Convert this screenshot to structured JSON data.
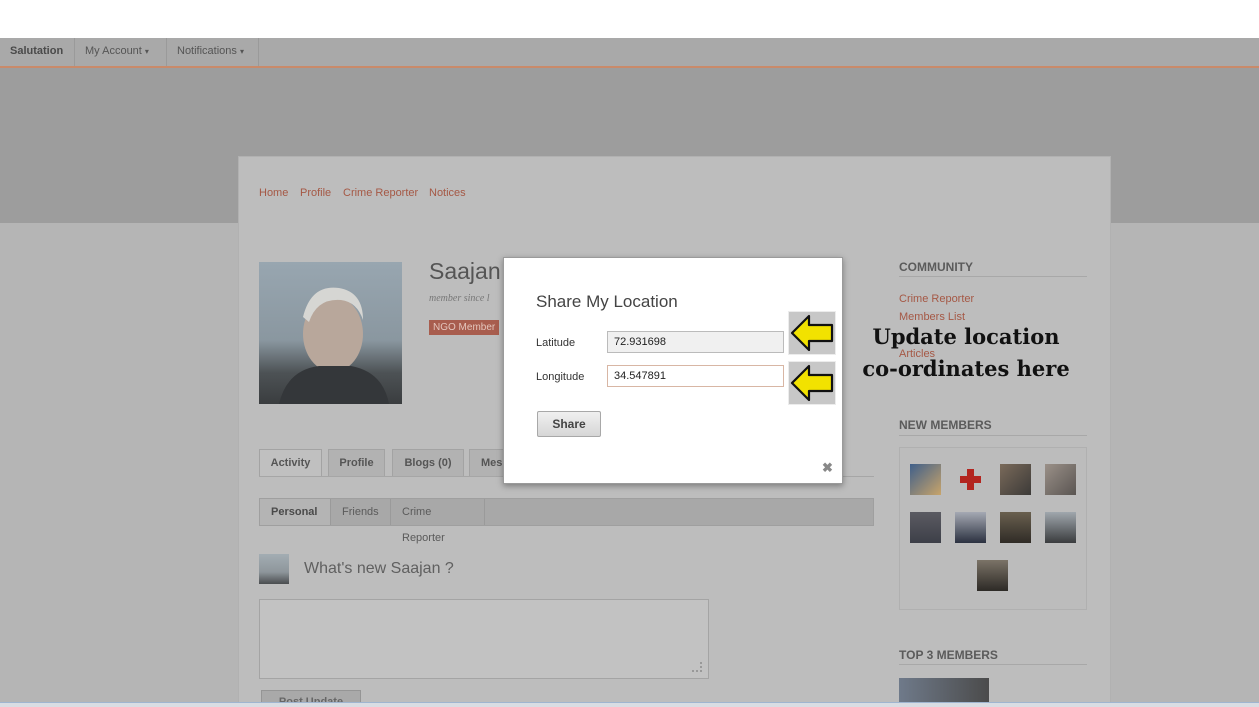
{
  "navbar": {
    "items": [
      "Salutation",
      "My Account",
      "Notifications"
    ],
    "dropdown_caret": "▾"
  },
  "breadcrumb": [
    "Home",
    "Profile",
    "Crime Reporter",
    "Notices"
  ],
  "profile": {
    "name": "Saajan",
    "member_since": "member since l",
    "badge": "NGO Member"
  },
  "tabs": [
    "Activity",
    "Profile",
    "Blogs (0)",
    "Mes"
  ],
  "subtabs": [
    "Personal",
    "Friends",
    "Crime Reporter"
  ],
  "activity": {
    "prompt": "What's new Saajan ?",
    "post_button": "Post Update"
  },
  "sidebar": {
    "community_title": "COMMUNITY",
    "community_links": [
      "Crime Reporter",
      "Members List",
      "Articles"
    ],
    "new_members_title": "NEW MEMBERS",
    "top3_title": "TOP 3 MEMBERS"
  },
  "modal": {
    "title": "Share My Location",
    "latitude_label": "Latitude",
    "latitude_value": "72.931698",
    "longitude_label": "Longitude",
    "longitude_value": "34.547891",
    "share_label": "Share",
    "close_glyph": "✖"
  },
  "annotation": {
    "line1": "Update location",
    "line2": "co-ordinates here",
    "arrow_color": "#f2e200"
  }
}
